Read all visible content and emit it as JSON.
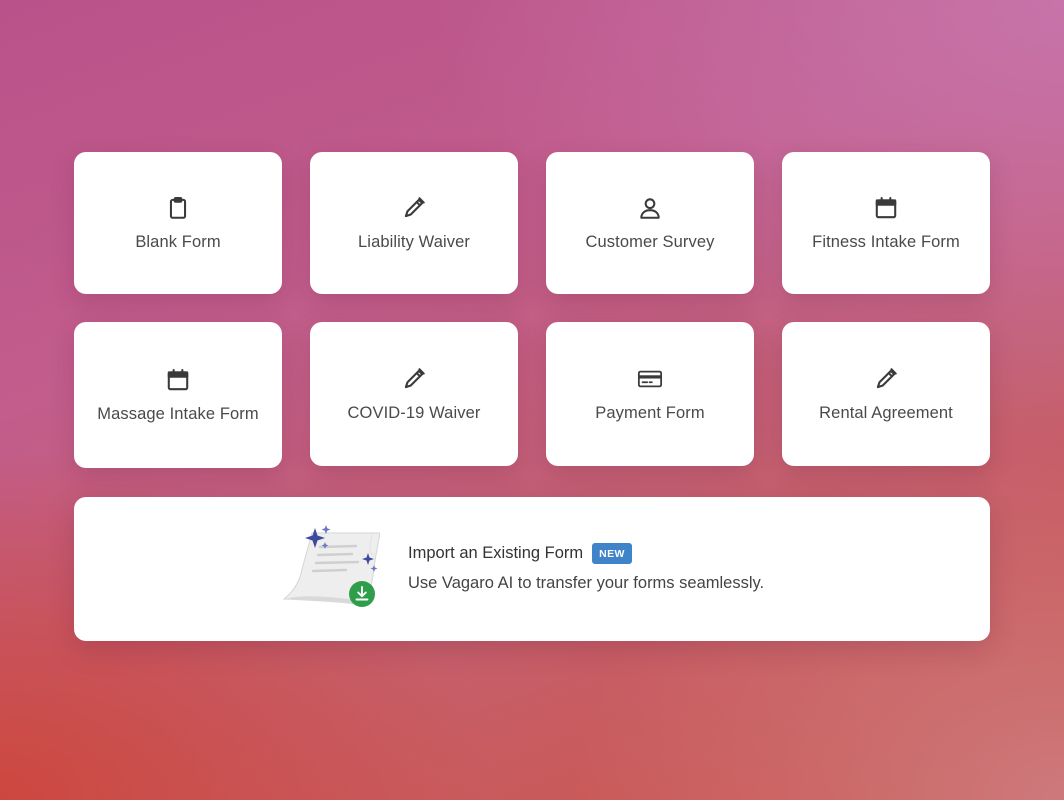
{
  "templates": [
    {
      "label": "Blank Form",
      "icon": "clipboard-icon"
    },
    {
      "label": "Liability Waiver",
      "icon": "pen-icon"
    },
    {
      "label": "Customer Survey",
      "icon": "person-icon"
    },
    {
      "label": "Fitness Intake Form",
      "icon": "calendar-icon"
    },
    {
      "label": "Massage Intake Form",
      "icon": "calendar-icon"
    },
    {
      "label": "COVID-19 Waiver",
      "icon": "pen-icon"
    },
    {
      "label": "Payment Form",
      "icon": "credit-card-icon"
    },
    {
      "label": "Rental Agreement",
      "icon": "pen-icon"
    }
  ],
  "import": {
    "title": "Import an Existing Form",
    "badge": "NEW",
    "description": "Use Vagaro AI to transfer your forms seamlessly."
  },
  "colors": {
    "icon": "#3a3a3a",
    "badge": "#3f83c9",
    "sparkle": "#3d4a9e",
    "download": "#2f9e4a"
  }
}
